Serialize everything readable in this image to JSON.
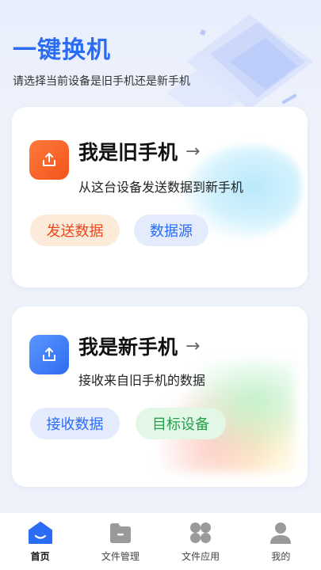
{
  "header": {
    "title": "一键换机",
    "subtitle": "请选择当前设备是旧手机还是新手机"
  },
  "old_phone_card": {
    "title": "我是旧手机",
    "arrow": "→",
    "description": "从这台设备发送数据到新手机",
    "primary_button": "发送数据",
    "secondary_button": "数据源",
    "icon": "upload-icon"
  },
  "new_phone_card": {
    "title": "我是新手机",
    "arrow": "→",
    "description": "接收来自旧手机的数据",
    "primary_button": "接收数据",
    "secondary_button": "目标设备",
    "icon": "upload-icon"
  },
  "tabbar": {
    "items": [
      {
        "label": "首页",
        "icon": "home-icon",
        "active": true
      },
      {
        "label": "文件管理",
        "icon": "folder-icon",
        "active": false
      },
      {
        "label": "文件应用",
        "icon": "apps-icon",
        "active": false
      },
      {
        "label": "我的",
        "icon": "person-icon",
        "active": false
      }
    ]
  },
  "colors": {
    "accent_blue": "#2b6cf5",
    "accent_orange": "#f2541b",
    "accent_green": "#23a04a"
  }
}
